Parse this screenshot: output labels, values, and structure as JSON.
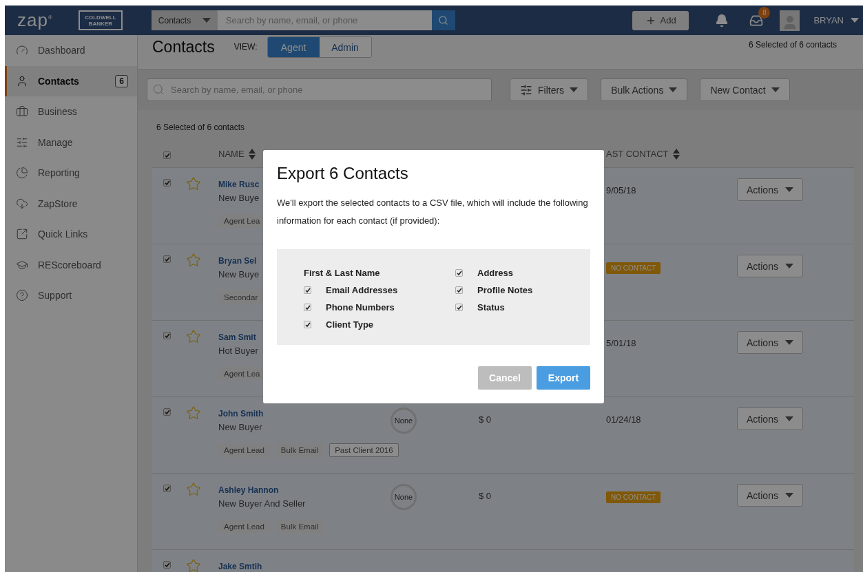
{
  "header": {
    "logo": "zap",
    "logo_mark": "®",
    "brand": "COLDWELL BANKER",
    "search": {
      "scope": "Contacts",
      "placeholder": "Search by name, email, or phone"
    },
    "add_button": "Add",
    "inbox_count": "8",
    "user": "BRYAN"
  },
  "sidebar": {
    "items": [
      {
        "label": "Dashboard",
        "selected": false
      },
      {
        "label": "Contacts",
        "selected": true,
        "count": "6"
      },
      {
        "label": "Business",
        "selected": false
      },
      {
        "label": "Manage",
        "selected": false
      },
      {
        "label": "Reporting",
        "selected": false
      },
      {
        "label": "ZapStore",
        "selected": false
      },
      {
        "label": "Quick Links",
        "selected": false
      },
      {
        "label": "REScoreboard",
        "selected": false
      },
      {
        "label": "Support",
        "selected": false
      }
    ]
  },
  "page": {
    "title": "Contacts",
    "view_label": "VIEW:",
    "views": [
      {
        "label": "Agent",
        "selected": true
      },
      {
        "label": "Admin",
        "selected": false
      }
    ],
    "selection_note": "6 Selected of 6 contacts"
  },
  "toolbar": {
    "search_placeholder": "Search by name, email, or phone",
    "buttons": [
      {
        "label": "Filters"
      },
      {
        "label": "Bulk Actions"
      },
      {
        "label": "New Contact"
      }
    ]
  },
  "list": {
    "count": "6 Selected of 6 contacts",
    "all_checked": true,
    "columns": [
      {
        "label": "NAME"
      },
      {
        "label": "AST CONTACT"
      }
    ],
    "rows": [
      {
        "checked": true,
        "name": "Mike Rusc",
        "type": "New Buye",
        "tags": [
          {
            "label": "Agent Lea",
            "kind": "filled"
          }
        ],
        "last_contact": {
          "kind": "date",
          "text": "9/05/18"
        },
        "action": "Actions"
      },
      {
        "checked": true,
        "name": "Bryan Sel",
        "type": "New Buye",
        "tags": [
          {
            "label": "Secondar",
            "kind": "filled"
          }
        ],
        "last_contact": {
          "kind": "badge",
          "text": "NO CONTACT"
        },
        "action": "Actions"
      },
      {
        "checked": true,
        "name": "Sam Smit",
        "type": "Hot Buyer",
        "tags": [
          {
            "label": "Agent Lea",
            "kind": "filled"
          }
        ],
        "last_contact": {
          "kind": "date",
          "text": "5/01/18"
        },
        "action": "Actions"
      },
      {
        "checked": true,
        "name": "John Smith",
        "type": "New Buyer",
        "tags": [
          {
            "label": "Agent Lead",
            "kind": "filled"
          },
          {
            "label": "Bulk Email",
            "kind": "filled"
          },
          {
            "label": "Past Client 2016",
            "kind": "outlined"
          }
        ],
        "score": "None",
        "value": "$ 0",
        "last_contact": {
          "kind": "date",
          "text": "01/24/18"
        },
        "action": "Actions"
      },
      {
        "checked": true,
        "name": "Ashley Hannon",
        "type": "New Buyer And Seller",
        "tags": [
          {
            "label": "Agent Lead",
            "kind": "filled"
          },
          {
            "label": "Bulk Email",
            "kind": "filled"
          }
        ],
        "score": "None",
        "value": "$ 0",
        "last_contact": {
          "kind": "badge",
          "text": "NO CONTACT"
        },
        "action": "Actions"
      },
      {
        "checked": true,
        "name": "Jake Smtih"
      }
    ]
  },
  "dialog": {
    "title": "Export 6 Contacts",
    "text": "We'll export the selected contacts to a CSV file, which will include the following information for each contact (if provided):",
    "field_columns": [
      {
        "fields": [
          {
            "label": "First & Last Name",
            "kind": "plain"
          },
          {
            "label": "Email Addresses",
            "kind": "checkbox",
            "checked": true
          },
          {
            "label": "Phone Numbers",
            "kind": "checkbox",
            "checked": true
          },
          {
            "label": "Client Type",
            "kind": "checkbox",
            "checked": true
          }
        ]
      },
      {
        "fields": [
          {
            "label": "Address",
            "kind": "checkbox",
            "checked": true
          },
          {
            "label": "Profile Notes",
            "kind": "checkbox",
            "checked": true
          },
          {
            "label": "Status",
            "kind": "checkbox",
            "checked": true
          }
        ]
      }
    ],
    "buttons": [
      {
        "label": "Cancel",
        "kind": "secondary"
      },
      {
        "label": "Export",
        "kind": "primary"
      }
    ]
  }
}
